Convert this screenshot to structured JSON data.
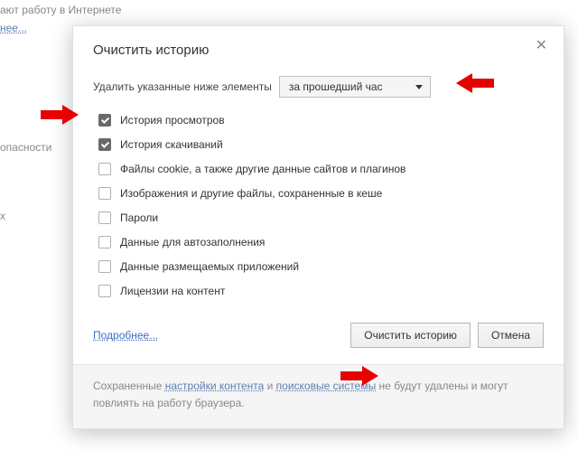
{
  "bg": {
    "line1": "ают работу в Интернете",
    "link1": "нее...",
    "line2": "опасности",
    "line3": "х"
  },
  "dialog": {
    "title": "Очистить историю",
    "close": "✕",
    "prompt": "Удалить указанные ниже элементы",
    "period": "за прошедший час",
    "options": [
      {
        "label": "История просмотров",
        "checked": true
      },
      {
        "label": "История скачиваний",
        "checked": true
      },
      {
        "label": "Файлы cookie, а также другие данные сайтов и плагинов",
        "checked": false
      },
      {
        "label": "Изображения и другие файлы, сохраненные в кеше",
        "checked": false
      },
      {
        "label": "Пароли",
        "checked": false
      },
      {
        "label": "Данные для автозаполнения",
        "checked": false
      },
      {
        "label": "Данные размещаемых приложений",
        "checked": false
      },
      {
        "label": "Лицензии на контент",
        "checked": false
      }
    ],
    "more": "Подробнее...",
    "confirm": "Очистить историю",
    "cancel": "Отмена",
    "footer": {
      "t1": "Сохраненные ",
      "link1": "настройки контента",
      "t2": " и ",
      "link2": "поисковые системы",
      "t3": " не будут удалены и могут повлиять на работу браузера."
    }
  },
  "annotations": {
    "arrow_color": "#e60000"
  }
}
